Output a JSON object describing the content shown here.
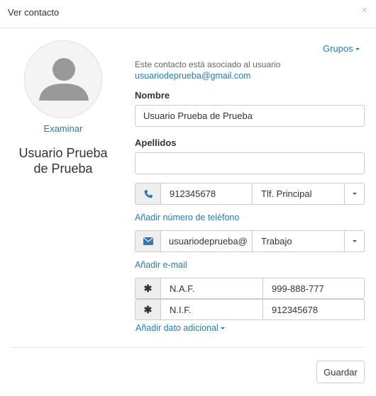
{
  "dialog": {
    "title": "Ver contacto",
    "close_glyph": "×"
  },
  "profile": {
    "browse_label": "Examinar",
    "full_name": "Usuario Prueba de Prueba"
  },
  "groups": {
    "label": "Grupos"
  },
  "association": {
    "text": "Este contacto está asociado al usuario",
    "email": "usuariodeprueba@gmail.com"
  },
  "name_field": {
    "label": "Nombre",
    "value": "Usuario Prueba de Prueba"
  },
  "surname_field": {
    "label": "Apellidos",
    "value": ""
  },
  "phone": {
    "icon": "phone-icon",
    "value": "912345678",
    "type": "Tlf. Principal",
    "add_label": "Añadir número de teléfono"
  },
  "email": {
    "icon": "envelope-icon",
    "value": "usuariodeprueba@",
    "type": "Trabajo",
    "add_label": "Añadir e-mail"
  },
  "extra_data": [
    {
      "icon": "asterisk-icon",
      "key": "N.A.F.",
      "value": "999-888-777"
    },
    {
      "icon": "asterisk-icon",
      "key": "N.I.F.",
      "value": "912345678"
    }
  ],
  "add_extra_label": "Añadir dato adicional",
  "save_label": "Guardar",
  "colors": {
    "link": "#2a7ab3",
    "border": "#cccccc",
    "addon_bg": "#eeeeee"
  }
}
